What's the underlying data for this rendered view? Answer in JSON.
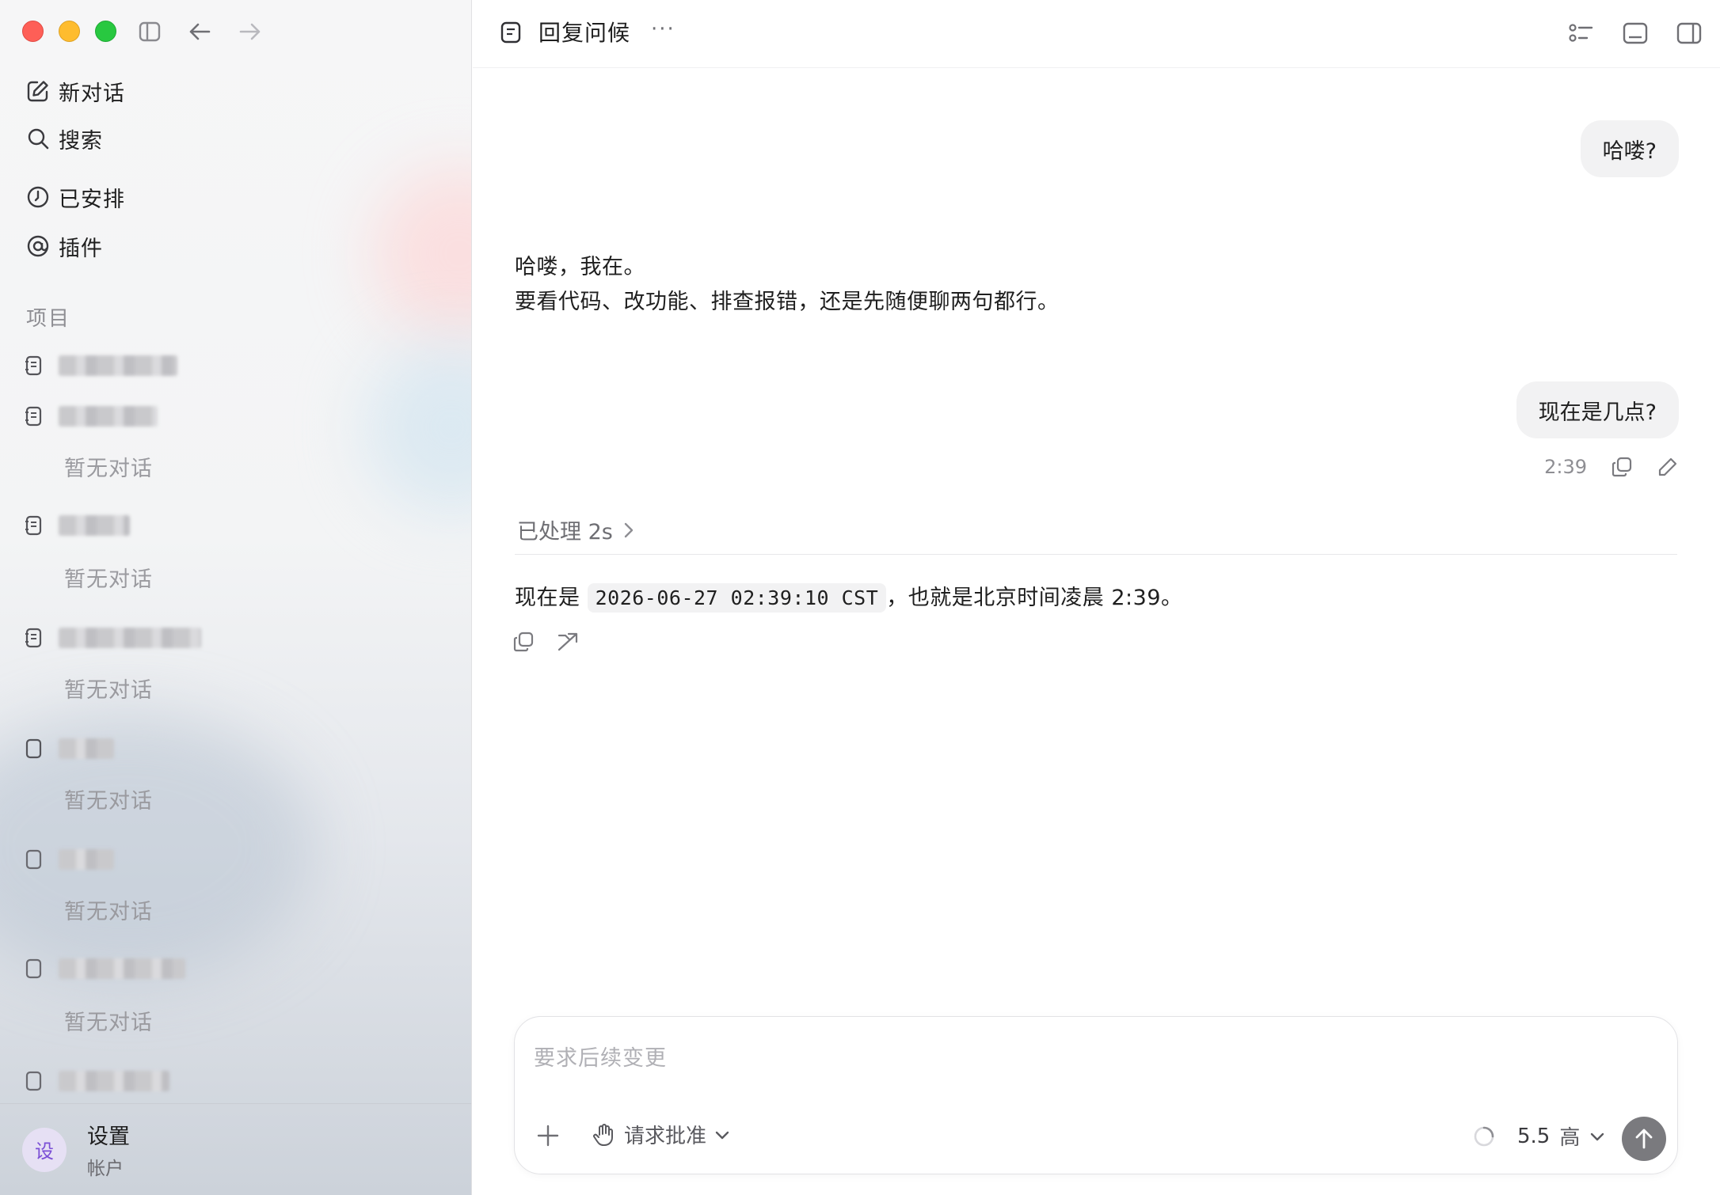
{
  "sidebar": {
    "nav": [
      {
        "label": "新对话",
        "icon": "compose-icon"
      },
      {
        "label": "搜索",
        "icon": "search-icon"
      },
      {
        "label": "已安排",
        "icon": "clock-icon"
      },
      {
        "label": "插件",
        "icon": "at-icon"
      }
    ],
    "section_label": "项目",
    "projects": [
      {
        "empty_label": ""
      },
      {
        "empty_label": "暂无对话"
      },
      {
        "empty_label": "暂无对话"
      },
      {
        "empty_label": "暂无对话"
      },
      {
        "empty_label": "暂无对话"
      },
      {
        "empty_label": "暂无对话"
      },
      {
        "empty_label": "暂无对话"
      },
      {
        "empty_label": ""
      }
    ],
    "footer": {
      "avatar": "设",
      "name": "设置",
      "subtitle": "帐户"
    }
  },
  "header": {
    "title": "回复问候",
    "more": "···"
  },
  "messages": {
    "user1": "哈喽?",
    "assistant1_line1": "哈喽，我在。",
    "assistant1_line2": "要看代码、改功能、排查报错，还是先随便聊两句都行。",
    "user2": "现在是几点?",
    "user2_time": "2:39",
    "processed": "已处理 2s",
    "assistant2_prefix": "现在是",
    "assistant2_code": "2026-06-27 02:39:10 CST",
    "assistant2_suffix": "，也就是北京时间凌晨 2:39。"
  },
  "composer": {
    "placeholder": "要求后续变更",
    "approval_label": "请求批准",
    "model": "5.5",
    "effort": "高"
  },
  "colors": {
    "accent": "#7b4fd6",
    "send_button": "#7a7a7e"
  }
}
